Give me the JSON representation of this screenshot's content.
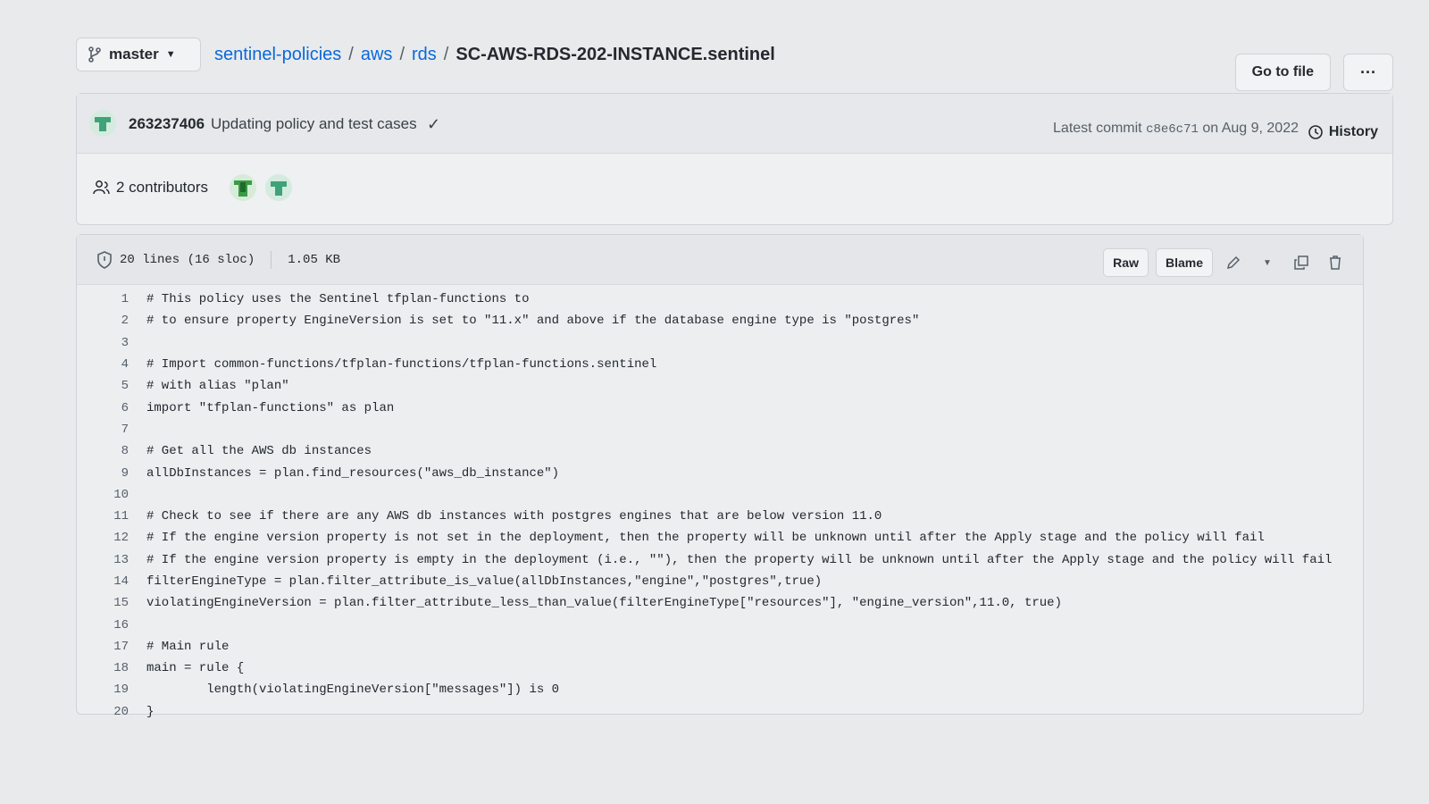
{
  "branch": {
    "name": "master"
  },
  "breadcrumb": {
    "repo": "sentinel-policies",
    "sep": "/",
    "dir1": "aws",
    "dir2": "rds",
    "file": "SC-AWS-RDS-202-INSTANCE.sentinel"
  },
  "header_buttons": {
    "goto_file": "Go to file",
    "more": "···"
  },
  "commit": {
    "author": "263237406",
    "message": "Updating policy and test cases",
    "check": "✓",
    "latest_prefix": "Latest commit",
    "sha": "c8e6c71",
    "date": "on Aug 9, 2022",
    "history": "History"
  },
  "contributors": {
    "label": "2 contributors"
  },
  "file": {
    "lines_info": "20 lines (16 sloc)",
    "size": "1.05 KB",
    "raw": "Raw",
    "blame": "Blame"
  },
  "code_lines": [
    "# This policy uses the Sentinel tfplan-functions to",
    "# to ensure property EngineVersion is set to \"11.x\" and above if the database engine type is \"postgres\"",
    "",
    "# Import common-functions/tfplan-functions/tfplan-functions.sentinel",
    "# with alias \"plan\"",
    "import \"tfplan-functions\" as plan",
    "",
    "# Get all the AWS db instances",
    "allDbInstances = plan.find_resources(\"aws_db_instance\")",
    "",
    "# Check to see if there are any AWS db instances with postgres engines that are below version 11.0",
    "# If the engine version property is not set in the deployment, then the property will be unknown until after the Apply stage and the policy will fail",
    "# If the engine version property is empty in the deployment (i.e., \"\"), then the property will be unknown until after the Apply stage and the policy will fail",
    "filterEngineType = plan.filter_attribute_is_value(allDbInstances,\"engine\",\"postgres\",true)",
    "violatingEngineVersion = plan.filter_attribute_less_than_value(filterEngineType[\"resources\"], \"engine_version\",11.0, true)",
    "",
    "# Main rule",
    "main = rule {",
    "        length(violatingEngineVersion[\"messages\"]) is 0",
    "}"
  ]
}
